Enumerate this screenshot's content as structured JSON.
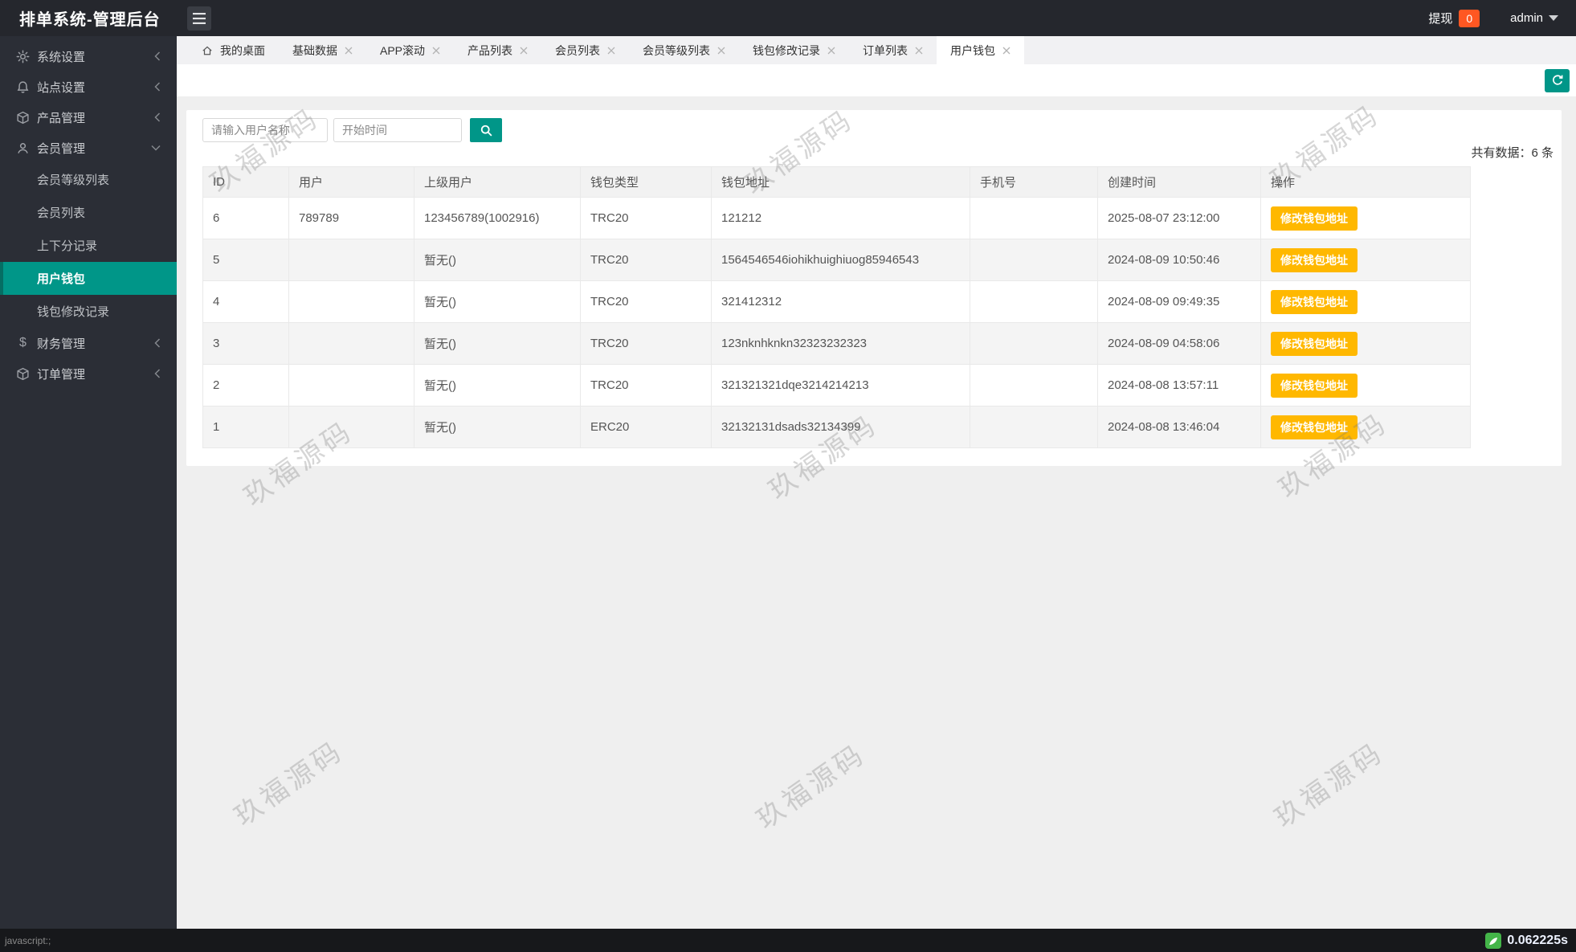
{
  "topbar": {
    "title": "排单系统-管理后台",
    "withdraw_label": "提现",
    "withdraw_count": "0",
    "username": "admin"
  },
  "sidebar": {
    "items": [
      {
        "label": "系统设置",
        "icon": "gear"
      },
      {
        "label": "站点设置",
        "icon": "bell"
      },
      {
        "label": "产品管理",
        "icon": "cube"
      },
      {
        "label": "会员管理",
        "icon": "user"
      },
      {
        "label": "财务管理",
        "icon": "dollar"
      },
      {
        "label": "订单管理",
        "icon": "cube"
      }
    ],
    "submenu": [
      {
        "label": "会员等级列表"
      },
      {
        "label": "会员列表"
      },
      {
        "label": "上下分记录"
      },
      {
        "label": "用户钱包"
      },
      {
        "label": "钱包修改记录"
      }
    ],
    "active_submenu": "用户钱包"
  },
  "tabs": [
    {
      "label": "我的桌面"
    },
    {
      "label": "基础数据"
    },
    {
      "label": "APP滚动"
    },
    {
      "label": "产品列表"
    },
    {
      "label": "会员列表"
    },
    {
      "label": "会员等级列表"
    },
    {
      "label": "钱包修改记录"
    },
    {
      "label": "订单列表"
    },
    {
      "label": "用户钱包"
    }
  ],
  "toolbar": {
    "username_placeholder": "请输入用户名称",
    "start_time_placeholder": "开始时间"
  },
  "summary": {
    "total": "共有数据：6 条"
  },
  "table": {
    "columns": [
      "ID",
      "用户",
      "上级用户",
      "钱包类型",
      "钱包地址",
      "手机号",
      "创建时间",
      "操作"
    ],
    "action_label": "修改钱包地址",
    "rows": [
      {
        "id": "6",
        "user": "789789",
        "parent_user": "123456789(1002916)",
        "wallet_type": "TRC20",
        "wallet_address": "121212",
        "phone": "",
        "created_at": "2025-08-07 23:12:00"
      },
      {
        "id": "5",
        "user": "",
        "parent_user": "暂无()",
        "wallet_type": "TRC20",
        "wallet_address": "1564546546iohikhuighiuog85946543",
        "phone": "",
        "created_at": "2024-08-09 10:50:46"
      },
      {
        "id": "4",
        "user": "",
        "parent_user": "暂无()",
        "wallet_type": "TRC20",
        "wallet_address": "321412312",
        "phone": "",
        "created_at": "2024-08-09 09:49:35"
      },
      {
        "id": "3",
        "user": "",
        "parent_user": "暂无()",
        "wallet_type": "TRC20",
        "wallet_address": "123nknhknkn32323232323",
        "phone": "",
        "created_at": "2024-08-09 04:58:06"
      },
      {
        "id": "2",
        "user": "",
        "parent_user": "暂无()",
        "wallet_type": "TRC20",
        "wallet_address": "321321321dqe3214214213",
        "phone": "",
        "created_at": "2024-08-08 13:57:11"
      },
      {
        "id": "1",
        "user": "",
        "parent_user": "暂无()",
        "wallet_type": "ERC20",
        "wallet_address": "32132131dsads32134399",
        "phone": "",
        "created_at": "2024-08-08 13:46:04"
      }
    ]
  },
  "footer": {
    "status_link": "javascript:;",
    "timer": "0.062225s"
  },
  "watermark": {
    "text": "玖福源码"
  },
  "colors": {
    "accent_teal": "#009688",
    "button_amber": "#ffb800",
    "badge_red": "#ff5722",
    "sidebar_dark": "#2b2e36"
  }
}
